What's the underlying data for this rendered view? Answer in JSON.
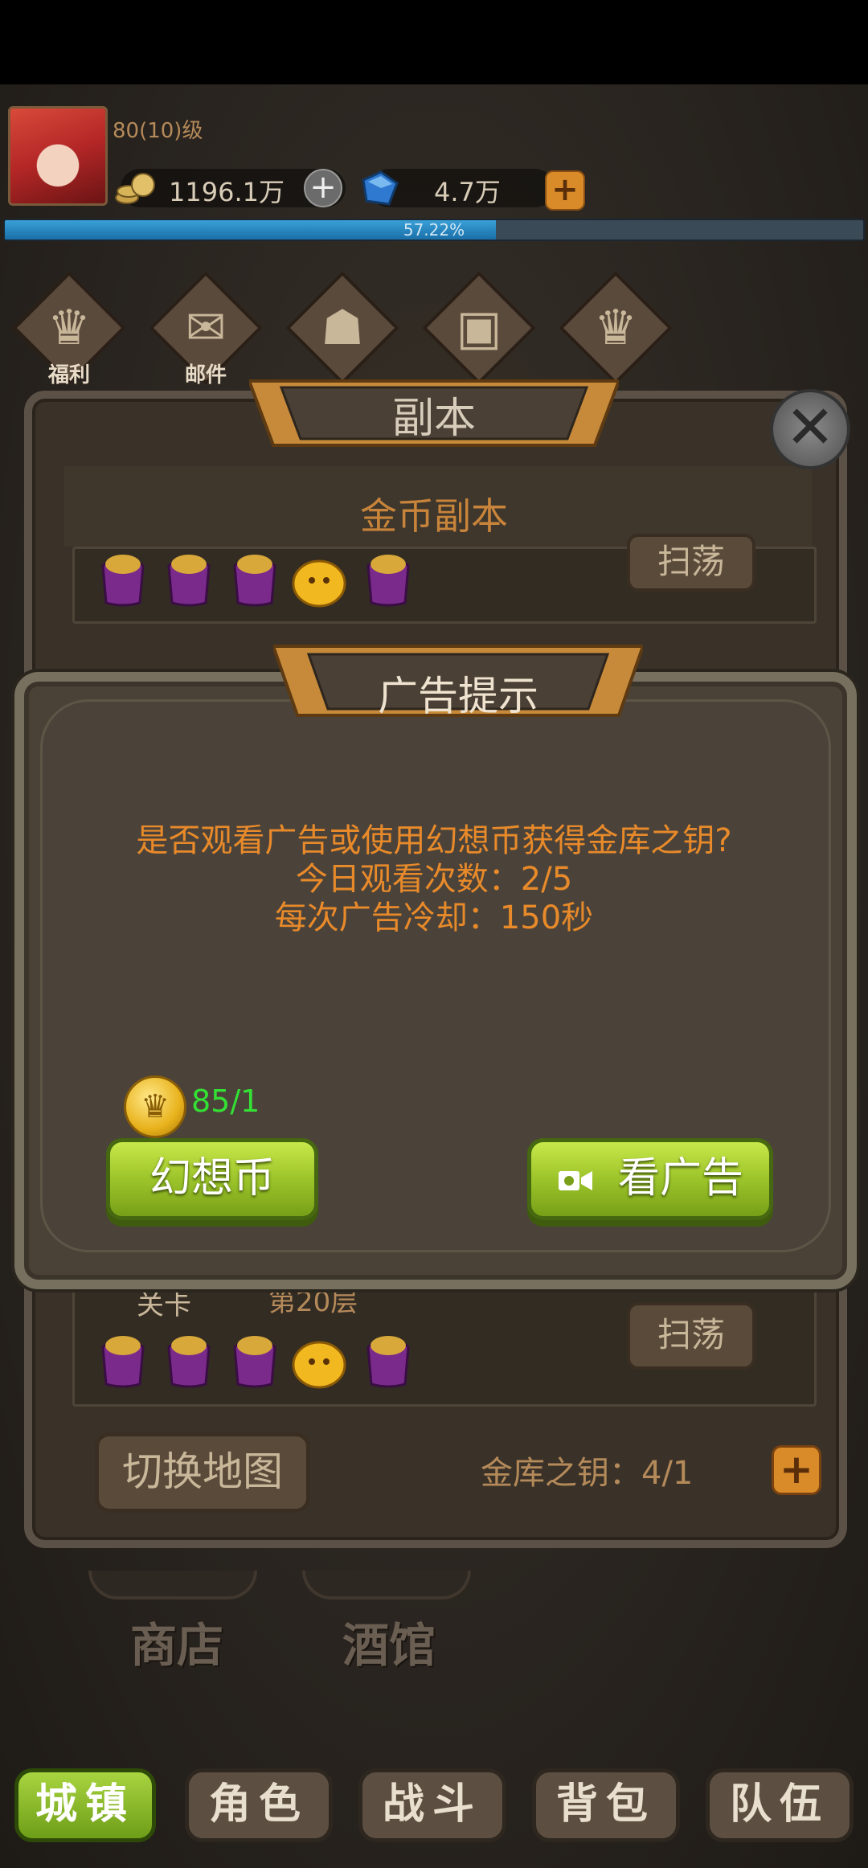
{
  "header": {
    "level": "80(10)级",
    "gold": "1196.1万",
    "gems": "4.7万",
    "exp_percent": "57.22%",
    "exp_fraction": 0.5722
  },
  "top_menu": [
    {
      "label": "福利",
      "icon": "crest-icon"
    },
    {
      "label": "邮件",
      "icon": "mail-icon"
    },
    {
      "label": "",
      "icon": "map-icon"
    },
    {
      "label": "",
      "icon": "chest-icon"
    },
    {
      "label": "",
      "icon": "crest-icon"
    }
  ],
  "dungeon": {
    "title": "副本",
    "subtitle": "金币副本",
    "stage1_sweep": "扫荡",
    "stage2_label": "关卡",
    "stage2_floor": "第20层",
    "stage2_sweep": "扫荡",
    "switch_map": "切换地图",
    "key_label": "金库之钥：4/1"
  },
  "ad_dialog": {
    "title": "广告提示",
    "message_line1": "是否观看广告或使用幻想币获得金库之钥?",
    "message_line2": "今日观看次数：2/5",
    "message_line3": "每次广告冷却：150秒",
    "coin_count": "85/1",
    "fantasy_coin_button": "幻想币",
    "watch_ad_button": "看广告"
  },
  "town": {
    "shop": "商店",
    "tavern": "酒馆"
  },
  "bottom_nav": [
    {
      "label": "城镇",
      "active": true
    },
    {
      "label": "角色",
      "active": false
    },
    {
      "label": "战斗",
      "active": false
    },
    {
      "label": "背包",
      "active": false
    },
    {
      "label": "队伍",
      "active": false
    }
  ],
  "colors": {
    "accent_orange": "#e88a2a",
    "green_button": "#9cc42a",
    "coin_count_green": "#34e034"
  }
}
